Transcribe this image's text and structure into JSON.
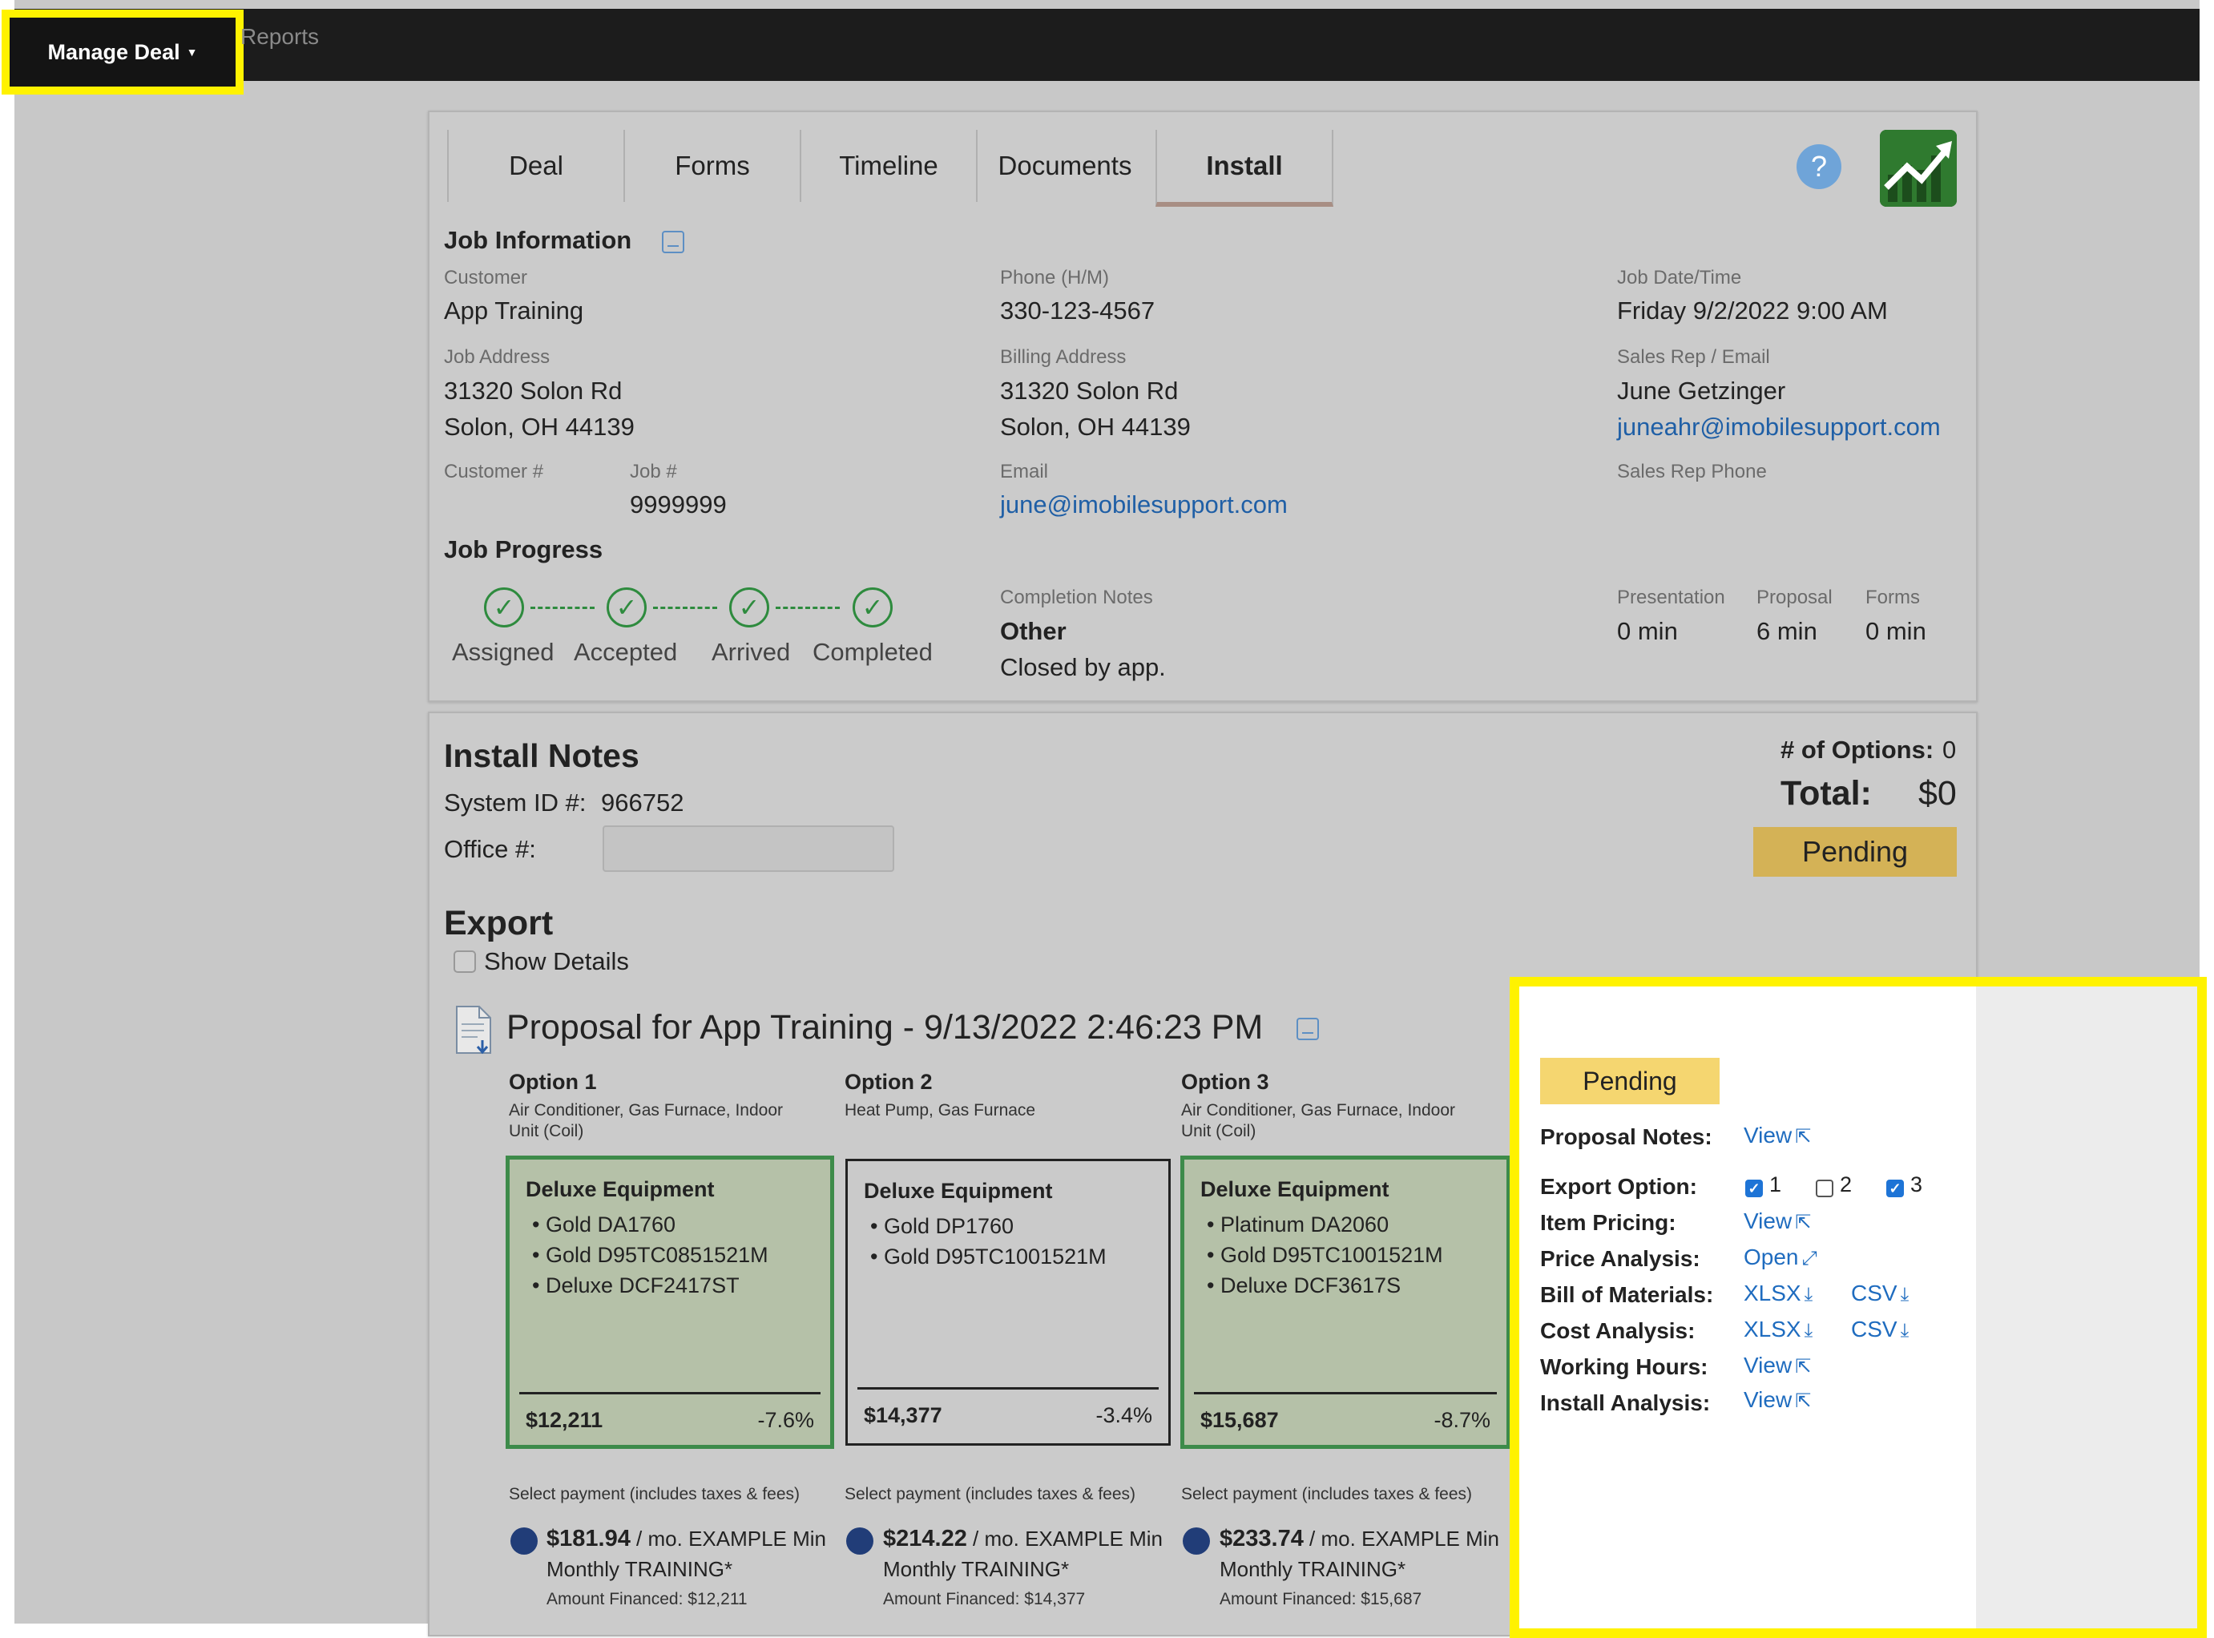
{
  "topnav": {
    "manage_deal": "Manage Deal",
    "reports": "Reports"
  },
  "tabs": [
    "Deal",
    "Forms",
    "Timeline",
    "Documents",
    "Install"
  ],
  "job_info": {
    "title": "Job Information",
    "customer_label": "Customer",
    "customer": "App Training",
    "phone_label": "Phone (H/M)",
    "phone": "330-123-4567",
    "job_datetime_label": "Job Date/Time",
    "job_datetime": "Friday 9/2/2022 9:00 AM",
    "job_address_label": "Job Address",
    "job_address_1": "31320 Solon Rd",
    "job_address_2": "Solon, OH 44139",
    "billing_address_label": "Billing Address",
    "billing_address_1": "31320 Solon Rd",
    "billing_address_2": "Solon, OH 44139",
    "sales_rep_label": "Sales Rep / Email",
    "sales_rep": "June Getzinger",
    "sales_rep_email": "juneahr@imobilesupport.com",
    "customer_num_label": "Customer #",
    "job_num_label": "Job #",
    "job_num": "9999999",
    "email_label": "Email",
    "email": "june@imobilesupport.com",
    "sales_rep_phone_label": "Sales Rep Phone"
  },
  "job_progress": {
    "title": "Job Progress",
    "steps": [
      "Assigned",
      "Accepted",
      "Arrived",
      "Completed"
    ],
    "completion_notes_label": "Completion Notes",
    "completion_type": "Other",
    "completion_note": "Closed by app.",
    "presentation_label": "Presentation",
    "presentation": "0 min",
    "proposal_label": "Proposal",
    "proposal": "6 min",
    "forms_label": "Forms",
    "forms": "0 min"
  },
  "install_notes": {
    "title": "Install Notes",
    "system_id_label": "System ID #:",
    "system_id": "966752",
    "office_label": "Office #:",
    "office_value": "",
    "num_options_label": "# of Options:",
    "num_options": "0",
    "total_label": "Total:",
    "total": "$0",
    "status": "Pending"
  },
  "export": {
    "title": "Export",
    "show_details": "Show Details",
    "proposal_title": "Proposal for App Training - 9/13/2022 2:46:23 PM"
  },
  "options": [
    {
      "title": "Option 1",
      "sub1": "Air Conditioner, Gas Furnace, Indoor",
      "sub2": "Unit (Coil)",
      "tier": "Deluxe Equipment",
      "items": [
        "Gold DA1760",
        "Gold D95TC0851521M",
        "Deluxe DCF2417ST"
      ],
      "price": "$12,211",
      "pct": "-7.6%",
      "selected": true,
      "pay_label": "Select payment (includes taxes & fees)",
      "monthly": "$181.94",
      "pay_text1": " / mo. EXAMPLE Min",
      "pay_text2": "Monthly TRAINING*",
      "financed": "Amount Financed: $12,211"
    },
    {
      "title": "Option 2",
      "sub1": "Heat Pump, Gas Furnace",
      "sub2": "",
      "tier": "Deluxe Equipment",
      "items": [
        "Gold DP1760",
        "Gold D95TC1001521M"
      ],
      "price": "$14,377",
      "pct": "-3.4%",
      "selected": false,
      "pay_label": "Select payment (includes taxes & fees)",
      "monthly": "$214.22",
      "pay_text1": " / mo. EXAMPLE Min",
      "pay_text2": "Monthly TRAINING*",
      "financed": "Amount Financed: $14,377"
    },
    {
      "title": "Option 3",
      "sub1": "Air Conditioner, Gas Furnace, Indoor",
      "sub2": "Unit (Coil)",
      "tier": "Deluxe Equipment",
      "items": [
        "Platinum DA2060",
        "Gold D95TC1001521M",
        "Deluxe DCF3617S"
      ],
      "price": "$15,687",
      "pct": "-8.7%",
      "selected": true,
      "pay_label": "Select payment (includes taxes & fees)",
      "monthly": "$233.74",
      "pay_text1": " / mo. EXAMPLE Min",
      "pay_text2": "Monthly TRAINING*",
      "financed": "Amount Financed: $15,687"
    }
  ],
  "export_panel": {
    "status": "Pending",
    "proposal_notes_label": "Proposal Notes:",
    "proposal_notes_link": "View",
    "export_option_label": "Export Option:",
    "export_options": [
      "1",
      "2",
      "3"
    ],
    "item_pricing_label": "Item Pricing:",
    "item_pricing_link": "View",
    "price_analysis_label": "Price Analysis:",
    "price_analysis_link": "Open",
    "bom_label": "Bill of Materials:",
    "bom_xlsx": "XLSX",
    "bom_csv": "CSV",
    "cost_analysis_label": "Cost Analysis:",
    "cost_xlsx": "XLSX",
    "cost_csv": "CSV",
    "working_hours_label": "Working Hours:",
    "working_hours_link": "View",
    "install_analysis_label": "Install Analysis:",
    "install_analysis_link": "View"
  }
}
